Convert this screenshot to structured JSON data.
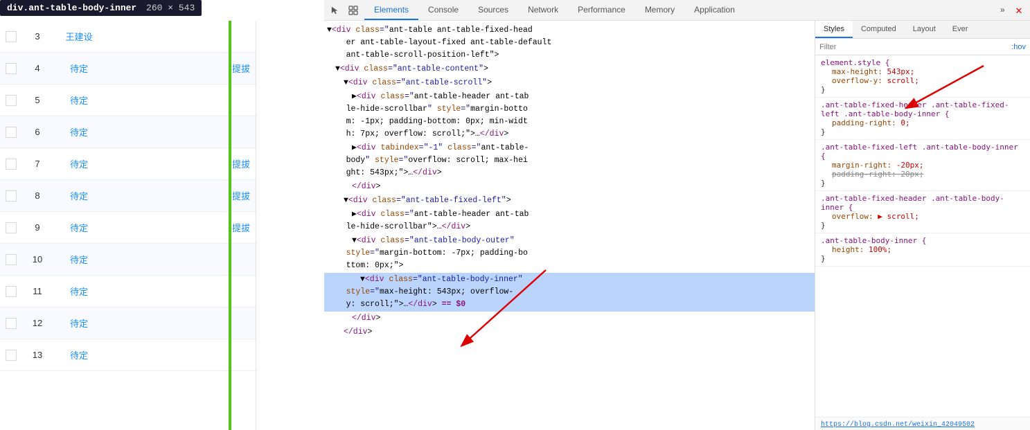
{
  "tooltip": {
    "class_name": "div.ant-table-body-inner",
    "dimensions": "260 × 543"
  },
  "left_table": {
    "rows": [
      {
        "num": "3",
        "name": "王建设",
        "status": "",
        "action": ""
      },
      {
        "num": "4",
        "name": "待定",
        "status": "",
        "action": "提拔"
      },
      {
        "num": "5",
        "name": "待定",
        "status": "",
        "action": ""
      },
      {
        "num": "6",
        "name": "待定",
        "status": "",
        "action": ""
      },
      {
        "num": "7",
        "name": "待定",
        "status": "",
        "action": "提拔"
      },
      {
        "num": "8",
        "name": "待定",
        "status": "",
        "action": "提拔"
      },
      {
        "num": "9",
        "name": "待定",
        "status": "",
        "action": "提拔"
      },
      {
        "num": "10",
        "name": "待定",
        "status": "",
        "action": ""
      },
      {
        "num": "11",
        "name": "待定",
        "status": "",
        "action": ""
      },
      {
        "num": "12",
        "name": "待定",
        "status": "",
        "action": ""
      },
      {
        "num": "13",
        "name": "待定",
        "status": "",
        "action": ""
      }
    ]
  },
  "devtools": {
    "tabs": [
      "Elements",
      "Console",
      "Sources",
      "Network",
      "Performance",
      "Memory",
      "Application"
    ],
    "active_tab": "Elements",
    "style_tabs": [
      "Styles",
      "Computed",
      "Layout",
      "Ever"
    ],
    "active_style_tab": "Styles",
    "filter_placeholder": "Filter",
    "filter_hov": ":hov",
    "dom_content": [
      {
        "indent": 0,
        "line": "▼<div class=\"ant-table ant-table-fixed-header ant-table-layout-fixed ant-table-default ant-table-scroll-position-left\">"
      },
      {
        "indent": 1,
        "line": "▼<div class=\"ant-table-content\">"
      },
      {
        "indent": 2,
        "line": "▼<div class=\"ant-table-scroll\">"
      },
      {
        "indent": 3,
        "line": "▶<div class=\"ant-table-header ant-table-hide-scrollbar\" style=\"margin-bottom: -1px; padding-bottom: 0px; min-width: 7px; overflow: scroll;\">…</div>"
      },
      {
        "indent": 3,
        "line": "▶<div tabindex=\"-1\" class=\"ant-table-body\" style=\"overflow: scroll; max-height: 543px;\">…</div>"
      },
      {
        "indent": 3,
        "line": "</div>"
      },
      {
        "indent": 2,
        "line": "▼<div class=\"ant-table-fixed-left\">"
      },
      {
        "indent": 3,
        "line": "▶<div class=\"ant-table-header ant-table-hide-scrollbar\">…</div>"
      },
      {
        "indent": 3,
        "line": "▼<div class=\"ant-table-body-outer\" style=\"margin-bottom: -7px; padding-bottom: 0px;\">"
      },
      {
        "indent": 4,
        "line": "▼<div class=\"ant-table-body-inner\" style=\"max-height: 543px; overflow-y: scroll;\">…</div> == $0"
      },
      {
        "indent": 3,
        "line": "</div>"
      },
      {
        "indent": 2,
        "line": "</div>"
      }
    ],
    "highlighted_line": 9,
    "styles": [
      {
        "selector": "element.style {",
        "props": [
          {
            "name": "max-height",
            "value": "543px;",
            "strikethrough": false
          },
          {
            "name": "overflow-y",
            "value": "scroll;",
            "strikethrough": false
          }
        ],
        "close": "}"
      },
      {
        "selector": ".ant-table-fixed-header .ant-table-fixed-left .ant-table-body-inner {",
        "props": [
          {
            "name": "padding-right",
            "value": "0;",
            "strikethrough": false
          }
        ],
        "close": "}"
      },
      {
        "selector": ".ant-table-fixed-left .ant-table-body-inner {",
        "props": [
          {
            "name": "margin-right",
            "value": "-20px;",
            "strikethrough": false
          },
          {
            "name": "padding-right",
            "value": "20px;",
            "strikethrough": true
          }
        ],
        "close": "}"
      },
      {
        "selector": ".ant-table-fixed-header .ant-table-body-inner {",
        "props": [
          {
            "name": "overflow",
            "value": "▶ scroll;",
            "strikethrough": false
          }
        ],
        "close": "}"
      },
      {
        "selector": ".ant-table-body-inner {",
        "props": [
          {
            "name": "height",
            "value": "100%;",
            "strikethrough": false
          }
        ],
        "close": "}"
      }
    ],
    "url_bar": "https://blog.csdn.net/weixin_42049502"
  }
}
